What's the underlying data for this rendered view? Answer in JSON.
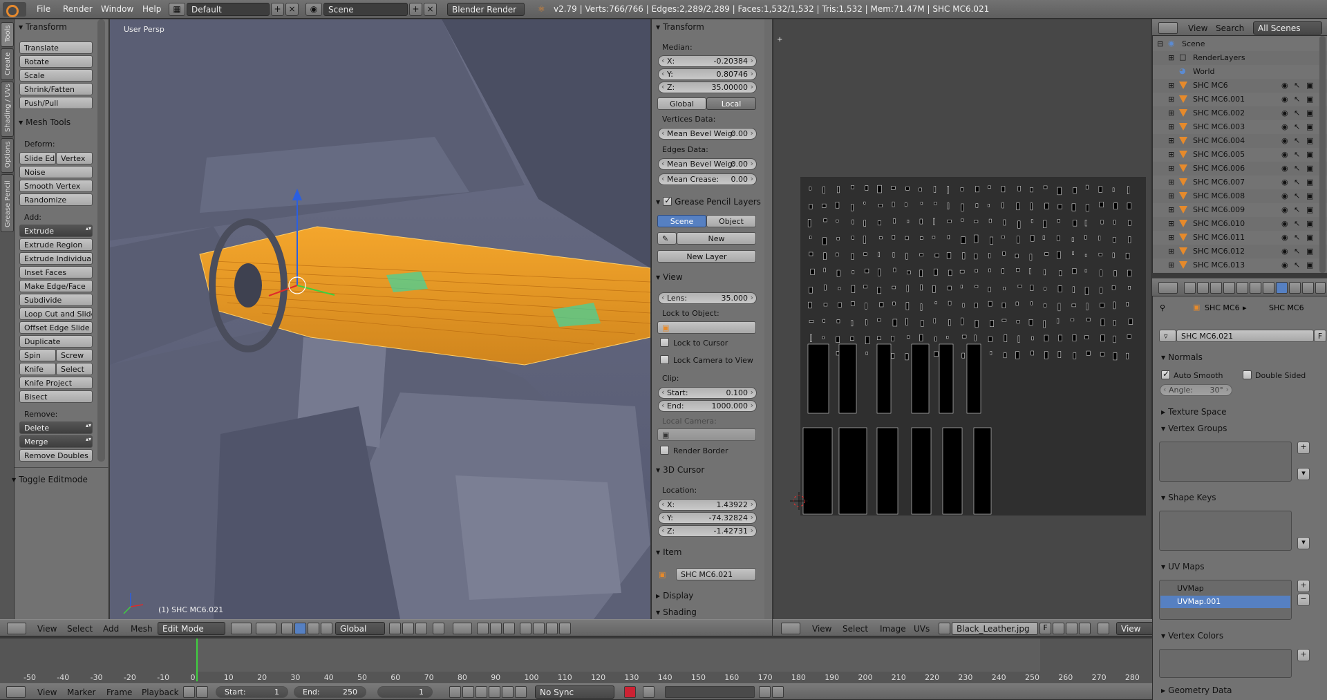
{
  "topbar": {
    "menus": [
      "File",
      "Render",
      "Window",
      "Help"
    ],
    "layout_name": "Default",
    "scene_name": "Scene",
    "engine": "Blender Render",
    "stats": "v2.79 | Verts:766/766 | Edges:2,289/2,289 | Faces:1,532/1,532 | Tris:1,532 | Mem:71.47M | SHC MC6.021"
  },
  "tabs": [
    "Tools",
    "Create",
    "Shading / UVs",
    "Options",
    "Grease Pencil"
  ],
  "toolshelf": {
    "transform_title": "Transform",
    "transform_buttons": [
      "Translate",
      "Rotate",
      "Scale",
      "Shrink/Fatten",
      "Push/Pull"
    ],
    "mesh_tools_title": "Mesh Tools",
    "deform_label": "Deform:",
    "slide_edge": "Slide Ed",
    "vertex": "Vertex",
    "noise": "Noise",
    "smooth_vertex": "Smooth Vertex",
    "randomize": "Randomize",
    "add_label": "Add:",
    "extrude": "Extrude",
    "add_buttons": [
      "Extrude Region",
      "Extrude Individual",
      "Inset Faces",
      "Make Edge/Face",
      "Subdivide",
      "Loop Cut and Slide",
      "Offset Edge Slide",
      "Duplicate"
    ],
    "spin": "Spin",
    "screw": "Screw",
    "knife": "Knife",
    "select": "Select",
    "knife_project": "Knife Project",
    "bisect": "Bisect",
    "remove_label": "Remove:",
    "delete": "Delete",
    "merge": "Merge",
    "remove_doubles": "Remove Doubles",
    "toggle_editmode": "Toggle Editmode"
  },
  "viewport": {
    "view_label": "User Persp",
    "object_label": "(1) SHC MC6.021"
  },
  "npanel": {
    "transform_title": "Transform",
    "median_label": "Median:",
    "median": [
      {
        "k": "X:",
        "v": "-0.20384"
      },
      {
        "k": "Y:",
        "v": "0.80746"
      },
      {
        "k": "Z:",
        "v": "35.00000"
      }
    ],
    "global": "Global",
    "local": "Local",
    "vertices_data": "Vertices Data:",
    "mean_bevel_v": {
      "k": "Mean Bevel Weig:",
      "v": "0.00"
    },
    "edges_data": "Edges Data:",
    "mean_bevel_e": {
      "k": "Mean Bevel Weig:",
      "v": "0.00"
    },
    "mean_crease": {
      "k": "Mean Crease:",
      "v": "0.00"
    },
    "grease_title": "Grease Pencil Layers",
    "scene": "Scene",
    "object": "Object",
    "new": "New",
    "new_layer": "New Layer",
    "view_title": "View",
    "lens": {
      "k": "Lens:",
      "v": "35.000"
    },
    "lock_object": "Lock to Object:",
    "lock_cursor": "Lock to Cursor",
    "lock_camera": "Lock Camera to View",
    "clip": "Clip:",
    "clip_start": {
      "k": "Start:",
      "v": "0.100"
    },
    "clip_end": {
      "k": "End:",
      "v": "1000.000"
    },
    "local_camera": "Local Camera:",
    "render_border": "Render Border",
    "cursor_title": "3D Cursor",
    "location": "Location:",
    "cursor": [
      {
        "k": "X:",
        "v": "1.43922"
      },
      {
        "k": "Y:",
        "v": "-74.32824"
      },
      {
        "k": "Z:",
        "v": "-1.42731"
      }
    ],
    "item_title": "Item",
    "item_name": "SHC MC6.021",
    "display_title": "Display",
    "shading_title": "Shading"
  },
  "view3d_header": {
    "menus": [
      "View",
      "Select",
      "Add",
      "Mesh"
    ],
    "mode": "Edit Mode",
    "orientation": "Global"
  },
  "uv_header": {
    "menus": [
      "View",
      "Select",
      "Image",
      "UVs"
    ],
    "image": "Black_Leather.jpg",
    "f": "F",
    "view": "View"
  },
  "outliner": {
    "header_view": "View",
    "header_search": "Search",
    "scenes": "All Scenes",
    "scene": "Scene",
    "renderlayers": "RenderLayers",
    "world": "World",
    "objects": [
      "SHC MC6",
      "SHC MC6.001",
      "SHC MC6.002",
      "SHC MC6.003",
      "SHC MC6.004",
      "SHC MC6.005",
      "SHC MC6.006",
      "SHC MC6.007",
      "SHC MC6.008",
      "SHC MC6.009",
      "SHC MC6.010",
      "SHC MC6.011",
      "SHC MC6.012",
      "SHC MC6.013"
    ]
  },
  "properties": {
    "crumb_object": "SHC MC6",
    "crumb_mesh": "SHC MC6",
    "mesh_name": "SHC MC6.021",
    "f": "F",
    "normals": "Normals",
    "auto_smooth": "Auto Smooth",
    "double_sided": "Double Sided",
    "angle": {
      "k": "Angle:",
      "v": "30°"
    },
    "texture_space": "Texture Space",
    "vertex_groups": "Vertex Groups",
    "shape_keys": "Shape Keys",
    "uv_maps": "UV Maps",
    "uvmap_items": [
      "UVMap",
      "UVMap.001"
    ],
    "vertex_colors": "Vertex Colors",
    "geometry_data": "Geometry Data"
  },
  "timeline": {
    "ticks": [
      "-50",
      "-40",
      "-30",
      "-20",
      "-10",
      "0",
      "10",
      "20",
      "30",
      "40",
      "50",
      "60",
      "70",
      "80",
      "90",
      "100",
      "110",
      "120",
      "130",
      "140",
      "150",
      "160",
      "170",
      "180",
      "190",
      "200",
      "210",
      "220",
      "230",
      "240",
      "250",
      "260",
      "270",
      "280"
    ],
    "current_frame_value": 0,
    "menus": [
      "View",
      "Marker",
      "Frame",
      "Playback"
    ],
    "start": {
      "k": "Start:",
      "v": "1"
    },
    "end": {
      "k": "End:",
      "v": "250"
    },
    "current": "1",
    "sync": "No Sync"
  },
  "colors": {
    "accent_blue": "#5680c2",
    "selection_orange": "#f0a020",
    "active_face": "#3dd6a0",
    "brand": "#e78a2e"
  }
}
